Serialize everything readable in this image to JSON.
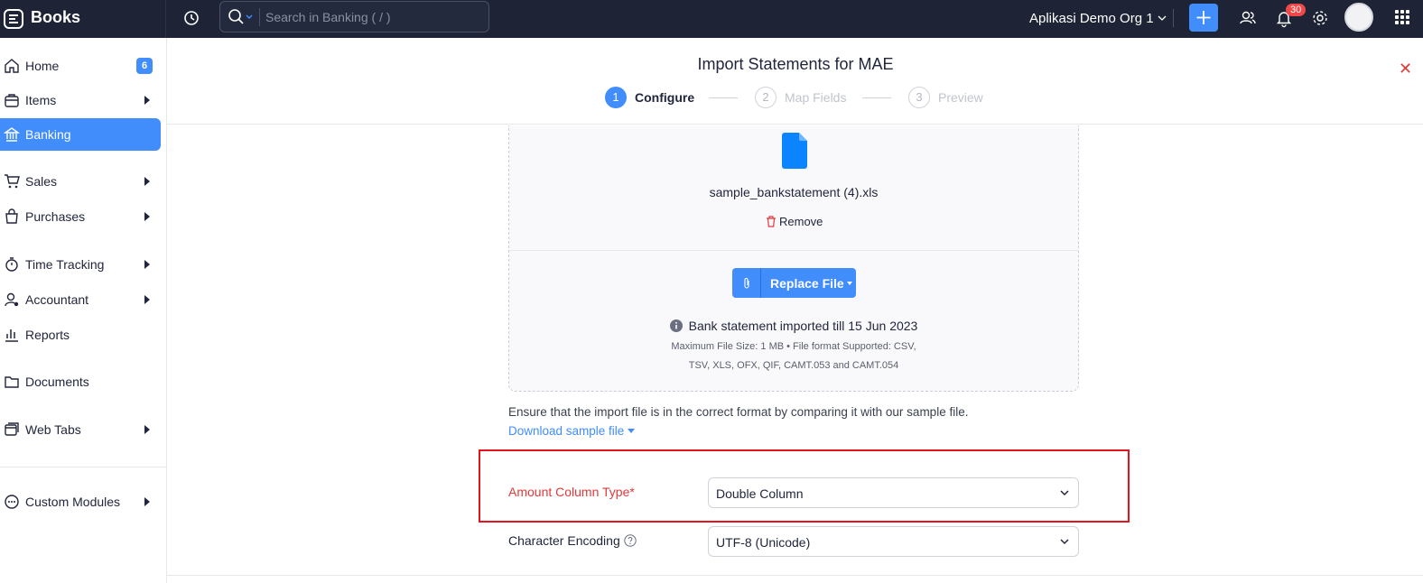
{
  "app": {
    "name": "Books",
    "org_name": "Aplikasi Demo Org 1",
    "notification_count": "30",
    "accent_color": "#408dfb"
  },
  "search": {
    "placeholder": "Search in Banking ( / )"
  },
  "sidebar": {
    "items": [
      {
        "label": "Home",
        "icon": "home-icon",
        "badge": "6"
      },
      {
        "label": "Items",
        "icon": "items-icon",
        "has_submenu": true
      },
      {
        "label": "Banking",
        "icon": "bank-icon",
        "active": true
      },
      {
        "label": "Sales",
        "icon": "cart-icon",
        "has_submenu": true
      },
      {
        "label": "Purchases",
        "icon": "bag-icon",
        "has_submenu": true
      },
      {
        "label": "Time Tracking",
        "icon": "stopwatch-icon",
        "has_submenu": true
      },
      {
        "label": "Accountant",
        "icon": "accountant-icon",
        "has_submenu": true
      },
      {
        "label": "Reports",
        "icon": "reports-icon"
      },
      {
        "label": "Documents",
        "icon": "folder-icon"
      },
      {
        "label": "Web Tabs",
        "icon": "web-tabs-icon",
        "has_submenu": true
      },
      {
        "label": "Custom Modules",
        "icon": "custom-modules-icon",
        "has_submenu": true
      }
    ]
  },
  "page": {
    "title": "Import Statements for MAE",
    "steps": [
      {
        "number": "1",
        "label": "Configure",
        "active": true
      },
      {
        "number": "2",
        "label": "Map Fields",
        "active": false
      },
      {
        "number": "3",
        "label": "Preview",
        "active": false
      }
    ]
  },
  "upload": {
    "file_name": "sample_bankstatement (4).xls",
    "remove_label": "Remove",
    "replace_label": "Replace File",
    "import_info": "Bank statement imported till 15 Jun 2023",
    "limits_line1": "Maximum File Size: 1 MB  •  File format Supported: CSV,",
    "limits_line2": "TSV, XLS, OFX, QIF, CAMT.053 and CAMT.054"
  },
  "hint": {
    "text": "Ensure that the import file is in the correct format by comparing it with our sample file.",
    "download_label": "Download sample file"
  },
  "form": {
    "amount_column_type": {
      "label": "Amount Column Type*",
      "value": "Double Column"
    },
    "character_encoding": {
      "label": "Character Encoding",
      "value": "UTF-8 (Unicode)"
    }
  }
}
